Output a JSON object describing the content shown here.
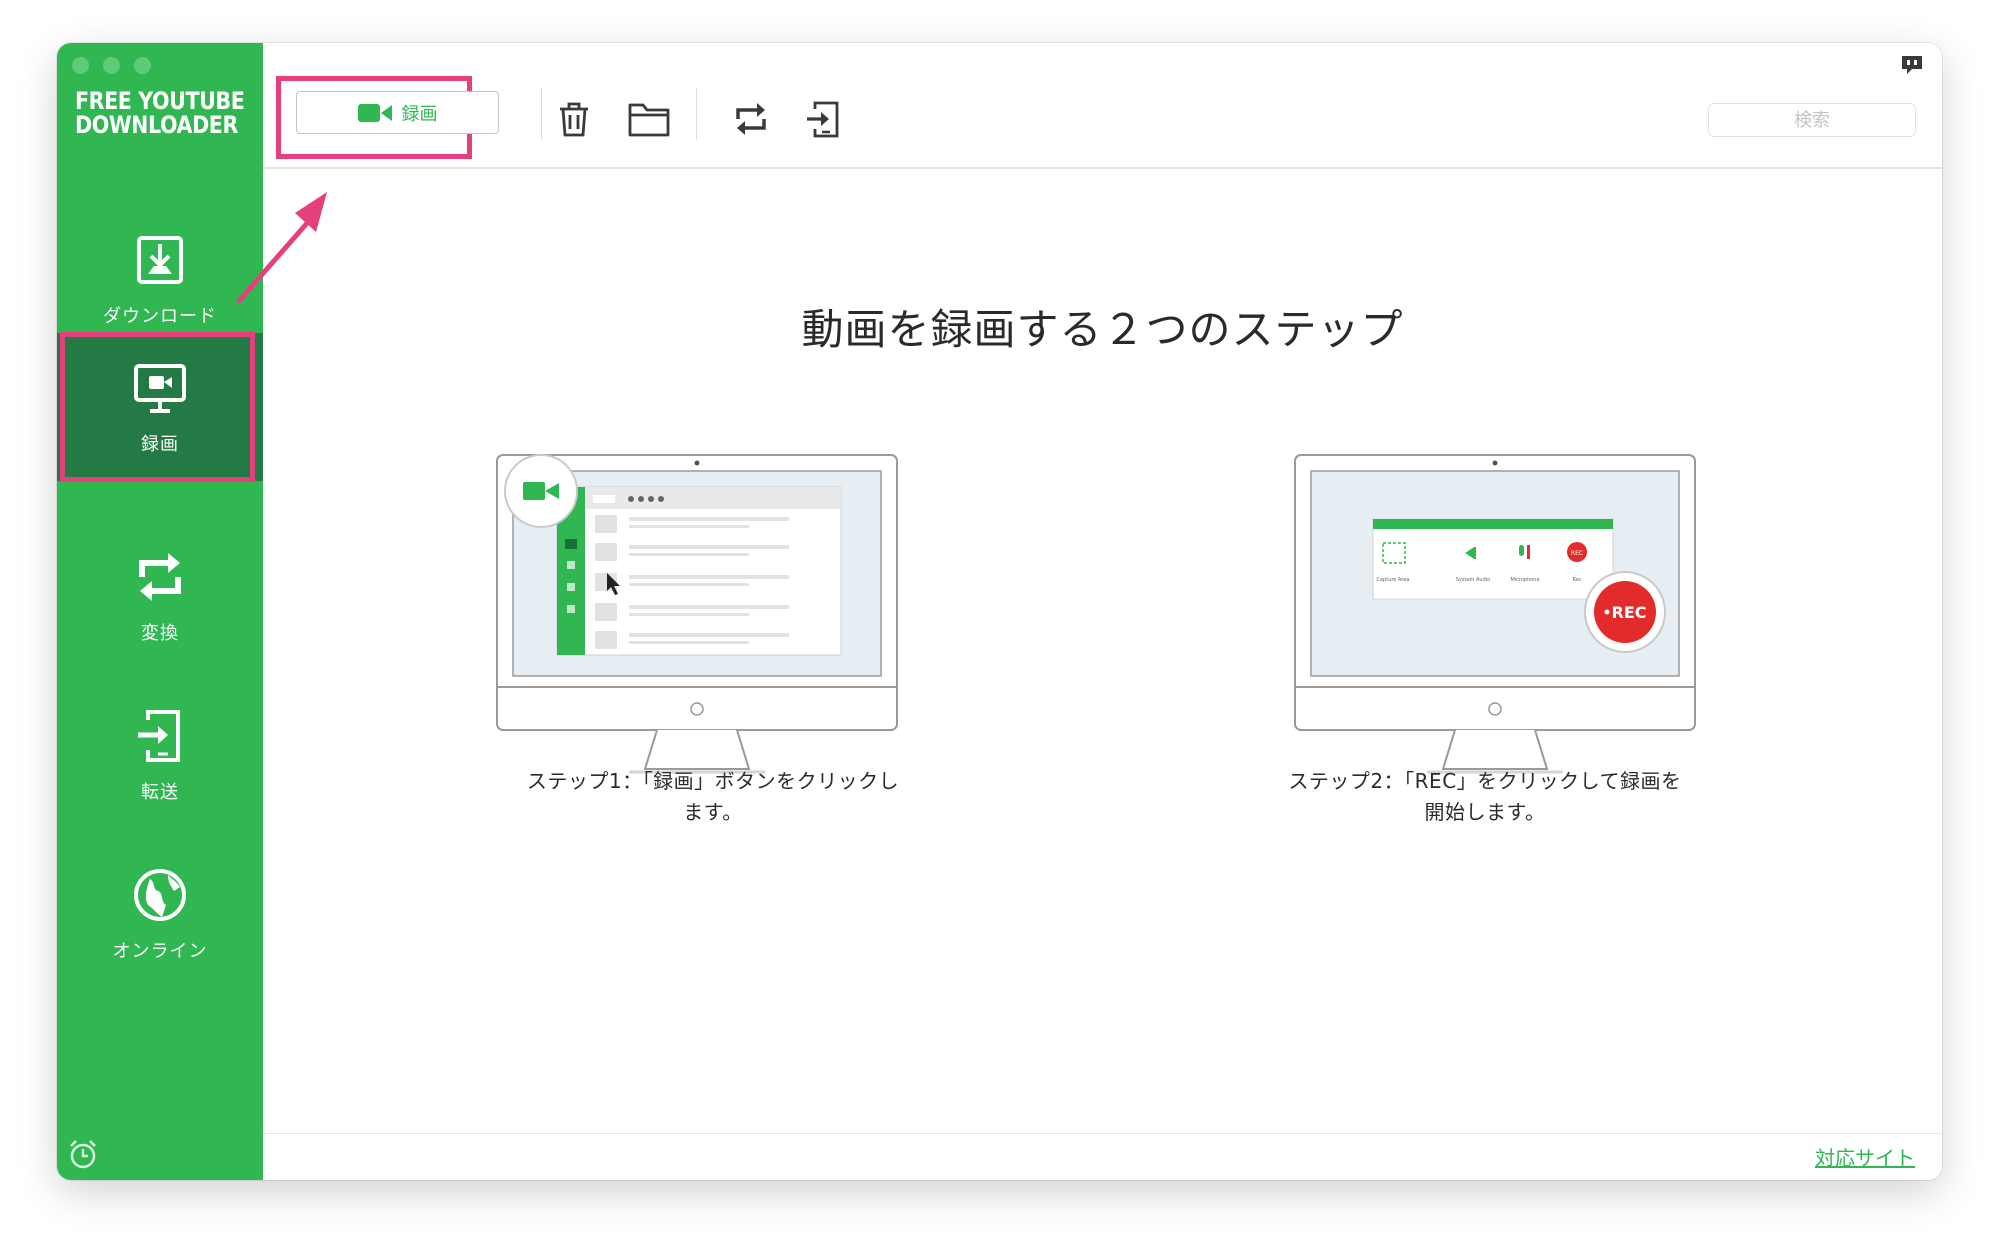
{
  "app": {
    "logo_line1": "FREE YOUTUBE",
    "logo_line2": "DOWNLOADER"
  },
  "sidebar": {
    "items": [
      {
        "label": "ダウンロード",
        "icon": "download-icon"
      },
      {
        "label": "録画",
        "icon": "screen-record-icon",
        "active": true
      },
      {
        "label": "変換",
        "icon": "convert-icon"
      },
      {
        "label": "転送",
        "icon": "transfer-icon"
      },
      {
        "label": "オンライン",
        "icon": "globe-icon"
      }
    ],
    "bottom_icon": "alarm-clock-icon"
  },
  "toolbar": {
    "record_label": "録画",
    "icons": [
      "trash-icon",
      "folder-icon",
      "convert-icon",
      "transfer-icon"
    ],
    "search_placeholder": "検索"
  },
  "main": {
    "heading": "動画を録画する２つのステップ",
    "steps": [
      {
        "caption_line1": "ステップ1：「録画」ボタンをクリックし",
        "caption_line2": "ます。"
      },
      {
        "caption_line1": "ステップ2：「REC」をクリックして録画を",
        "caption_line2": "開始します。"
      }
    ],
    "illustration2": {
      "labels": [
        "Capture Area",
        "System Audio",
        "Microphone",
        "Rec"
      ],
      "rec_badge": "REC"
    }
  },
  "footer": {
    "link": "対応サイト"
  },
  "colors": {
    "brand_green": "#30b752",
    "active_green": "#237a44",
    "highlight_pink": "#e53f7d",
    "rec_red": "#e32b2b"
  }
}
